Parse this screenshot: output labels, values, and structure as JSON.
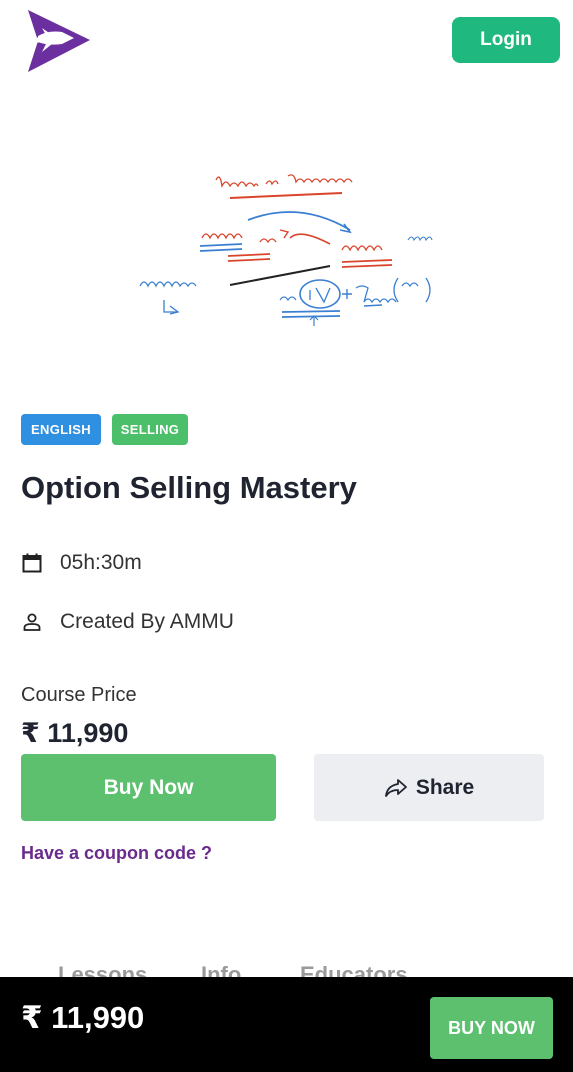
{
  "header": {
    "logo_icon": "rocket-play-logo-icon",
    "brand_color": "#6b2fa0",
    "login_label": "Login",
    "login_color": "#1fb97f"
  },
  "course": {
    "thumbnail_icon": "whiteboard-sketch",
    "tags": [
      {
        "label": "ENGLISH",
        "color": "#2f8fe0"
      },
      {
        "label": "SELLING",
        "color": "#4cbf6a"
      }
    ],
    "title": "Option Selling Mastery",
    "duration_icon": "calendar-icon",
    "duration": "05h:30m",
    "creator_icon": "person-icon",
    "creator": "Created By AMMU",
    "price_label": "Course Price",
    "price": "₹ 11,990"
  },
  "actions": {
    "buy_label": "Buy Now",
    "share_label": "Share",
    "share_icon": "share-arrow-icon",
    "coupon_text": "Have a coupon code ?"
  },
  "tabs": [
    "Lessons",
    "Info",
    "Educators"
  ],
  "bottom_bar": {
    "price": "₹ 11,990",
    "buy_label": "BUY NOW"
  }
}
